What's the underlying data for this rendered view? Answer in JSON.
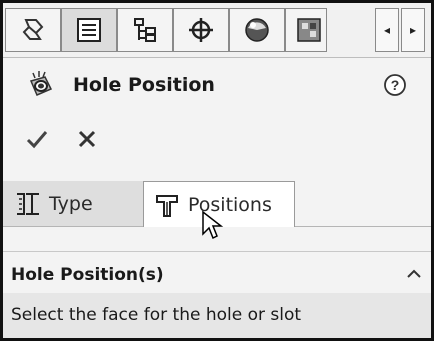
{
  "toolbar": {
    "icons": [
      "feature-manager-icon",
      "property-manager-icon",
      "configuration-manager-icon",
      "dimxpert-manager-icon",
      "display-manager-icon",
      "cam-manager-icon"
    ],
    "scroll_left_glyph": "◂",
    "scroll_right_glyph": "▸"
  },
  "header": {
    "title": "Hole Position",
    "help_glyph": "?"
  },
  "actions": {
    "ok": "✔",
    "cancel": "✕"
  },
  "tabs": [
    {
      "label": "Type",
      "active": false
    },
    {
      "label": "Positions",
      "active": true
    }
  ],
  "section": {
    "title": "Hole Position(s)",
    "text": "Select the face for the hole or slot"
  }
}
